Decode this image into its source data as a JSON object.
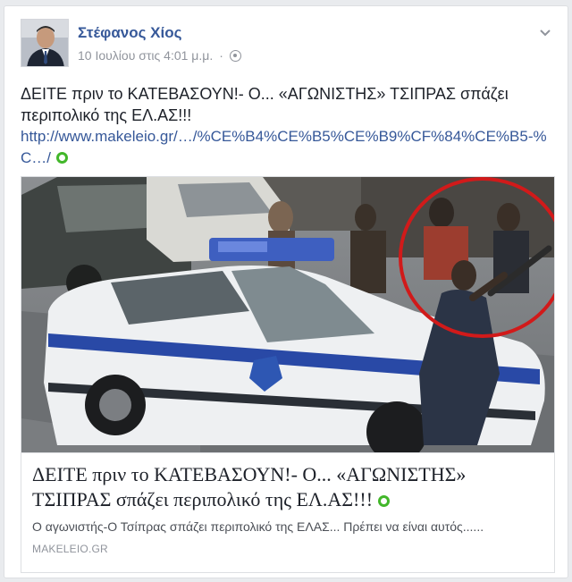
{
  "post": {
    "author": "Στέφανος Χίος",
    "timestamp": "10 Ιουλίου στις 4:01 μ.μ.",
    "separator": "·",
    "privacy_icon": "globe-icon",
    "options_icon": "chevron-down-icon",
    "text": "ΔΕΙΤΕ πριν το ΚΑΤΕΒΑΣΟΥΝ!- Ο... «ΑΓΩΝΙΣΤΗΣ» ΤΣΙΠΡΑΣ σπάζει περιπολικό της ΕΛ.ΑΣ!!!",
    "link": "http://www.makeleio.gr/…/%CE%B4%CE%B5%CE%B9%CF%84%CE%B5-%C…/"
  },
  "card": {
    "title": "ΔΕΙΤΕ πριν το ΚΑΤΕΒΑΣΟΥΝ!- Ο... «ΑΓΩΝΙΣΤΗΣ» ΤΣΙΠΡΑΣ σπάζει περιπολικό της ΕΛ.ΑΣ!!!",
    "description": "Ο αγωνιστής-Ο Τσίπρας σπάζει περιπολικό της ΕΛΑΣ... Πρέπει να είναι αυτός......",
    "domain": "MAKELEIO.GR"
  },
  "colors": {
    "link": "#365899",
    "accent_green": "#42b72a",
    "circle_annotation": "#d11a1a"
  }
}
